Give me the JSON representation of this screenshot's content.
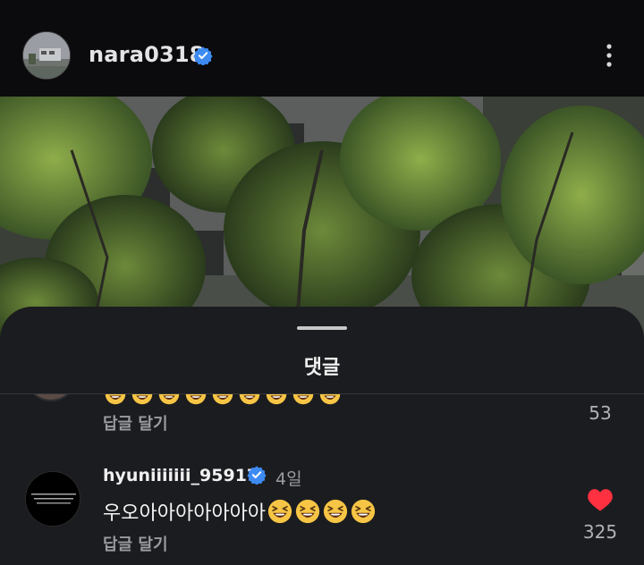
{
  "header": {
    "username": "nara0318",
    "verified_icon": "verified-badge-icon",
    "more_icon": "more-vertical-icon"
  },
  "sheet": {
    "title": "댓글"
  },
  "comments": [
    {
      "emoji_icon": "laughing-face-emoji",
      "emoji_count_visible": 9,
      "reply_label": "답글 달기",
      "likes": "53"
    },
    {
      "username": "hyuniiiiiii_95917",
      "time": "4일",
      "text": "우오아아아아아아아",
      "emoji_icon": "laughing-face-emoji",
      "emoji_count": 4,
      "reply_label": "답글 달기",
      "likes": "325",
      "liked": true,
      "like_color": "#ff3040"
    }
  ],
  "colors": {
    "verified": "#3d8bf2",
    "sheet_bg": "#1b1c1f",
    "header_bg": "#0b0b0d"
  }
}
